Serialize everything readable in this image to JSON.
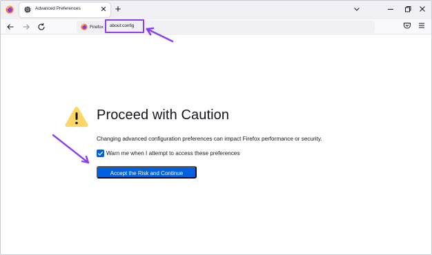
{
  "browser": {
    "tab": {
      "title": "Advanced Preferences",
      "close_label": "✕"
    },
    "new_tab_label": "+",
    "identity_label": "Firefox",
    "url": "about:config"
  },
  "page": {
    "heading": "Proceed with Caution",
    "description": "Changing advanced configuration preferences can impact Firefox performance or security.",
    "warn_checkbox": {
      "label": "Warn me when I attempt to access these preferences",
      "checked": true
    },
    "accept_button": "Accept the Risk and Continue"
  },
  "colors": {
    "accent": "#0061e0",
    "annotation": "#8a3ff0",
    "warning": "#ffd567"
  },
  "icons": [
    "firefox-logo-icon",
    "gear-icon",
    "close-icon",
    "plus-icon",
    "chevron-down-icon",
    "minimize-icon",
    "maximize-icon",
    "window-close-icon",
    "back-arrow-icon",
    "forward-arrow-icon",
    "reload-icon",
    "bookmark-star-icon",
    "pocket-icon",
    "hamburger-menu-icon",
    "warning-triangle-icon",
    "annotation-arrow-icon"
  ]
}
